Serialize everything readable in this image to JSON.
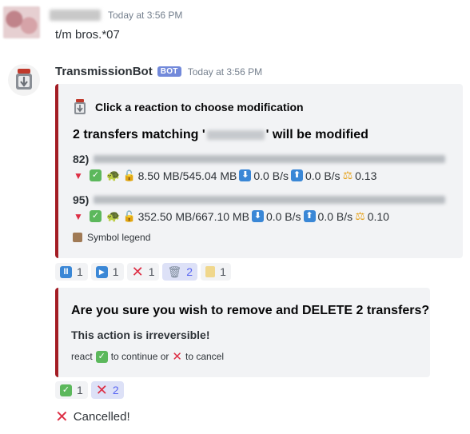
{
  "message1": {
    "timestamp": "Today at 3:56 PM",
    "text": "t/m bros.*07"
  },
  "message2": {
    "author": "TransmissionBot",
    "bot_tag": "BOT",
    "timestamp": "Today at 3:56 PM",
    "embed1": {
      "header": "Click a reaction to choose modification",
      "title_prefix": "2 transfers matching '",
      "title_suffix": "' will be modified",
      "transfers": [
        {
          "num": "82)",
          "size": "8.50 MB/545.04 MB",
          "down": "0.0 B/s",
          "up": "0.0 B/s",
          "ratio": "0.13"
        },
        {
          "num": "95)",
          "size": "352.50 MB/667.10 MB",
          "down": "0.0 B/s",
          "up": "0.0 B/s",
          "ratio": "0.10"
        }
      ],
      "legend": "Symbol legend"
    },
    "reactions1": [
      {
        "icon": "pause-icon",
        "count": "1",
        "active": false
      },
      {
        "icon": "play-icon",
        "count": "1",
        "active": false
      },
      {
        "icon": "x-icon",
        "count": "1",
        "active": false
      },
      {
        "icon": "wastebasket-icon",
        "count": "2",
        "active": true
      },
      {
        "icon": "scroll-icon",
        "count": "1",
        "active": false
      }
    ],
    "embed2": {
      "title": "Are you sure you wish to remove and DELETE 2 transfers?",
      "warning": "This action is irreversible!",
      "react_pre": "react",
      "react_mid": "to continue or",
      "react_post": "to cancel"
    },
    "reactions2": [
      {
        "icon": "check-icon",
        "count": "1",
        "active": false
      },
      {
        "icon": "x-icon",
        "count": "2",
        "active": true
      }
    ],
    "cancelled": "Cancelled!"
  },
  "colors": {
    "embed_border": "#a31c24",
    "bot_tag": "#7289da",
    "check": "#5cb85c",
    "arrow": "#3a87d6",
    "cross": "#dd2e44"
  }
}
